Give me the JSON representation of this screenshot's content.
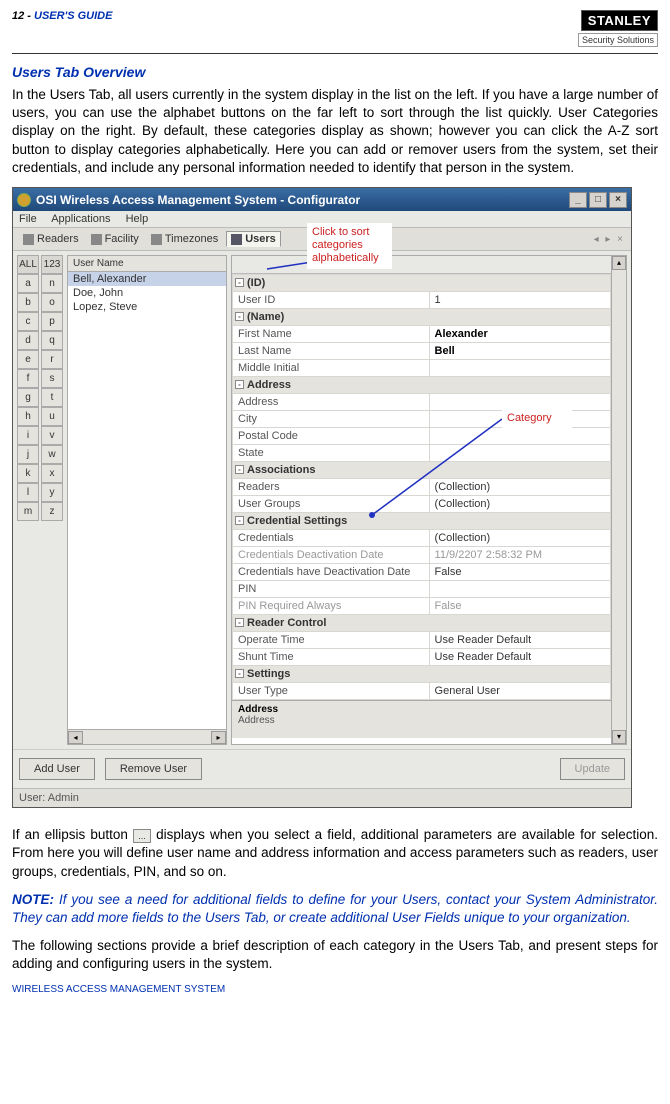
{
  "header": {
    "page_label": "12 - ",
    "guide_label": "USER'S GUIDE",
    "logo_main": "STANLEY",
    "logo_sub": "Security Solutions"
  },
  "section_title": "Users Tab Overview",
  "para1": "In the Users Tab, all users currently in the system display in the list on the left.   If you have a large number of users, you can use the alphabet buttons on the far left to sort through the list quickly.   User Categories display on the right.   By default, these categories display as shown; however you can click the A-Z sort button to display categories alphabetically.   Here you can add or remover users from the system, set their credentials, and include any personal information needed to identify that person in the system.",
  "para2a": "If an ellipsis button ",
  "para2b": " displays when you select a field, additional parameters are available for selection. From here you will define user name and address information and access parameters such as readers, user groups, credentials, PIN, and so on.",
  "note_label": "NOTE:",
  "note_body": "   If you see a need for additional fields to define for your Users, contact your System Administrator.    They can add more fields to the Users Tab, or create additional User Fields unique to your organization.",
  "para3": "The following sections provide a brief description of each category in the Users Tab, and present steps for adding and configuring users in the system.",
  "footer": "WIRELESS ACCESS MANAGEMENT SYSTEM",
  "callouts": {
    "sort": "Click to sort categories alphabetically",
    "category": "Category"
  },
  "window": {
    "title": "OSI Wireless Access Management System - Configurator",
    "menus": [
      "File",
      "Applications",
      "Help"
    ],
    "tabs": [
      "Readers",
      "Facility",
      "Timezones",
      "Users"
    ],
    "alpha_headers": [
      "ALL",
      "123"
    ],
    "alpha_left": [
      "a",
      "b",
      "c",
      "d",
      "e",
      "f",
      "g",
      "h",
      "i",
      "j",
      "k",
      "l",
      "m"
    ],
    "alpha_right": [
      "n",
      "o",
      "p",
      "q",
      "r",
      "s",
      "t",
      "u",
      "v",
      "w",
      "x",
      "y",
      "z"
    ],
    "userlist_header": "User Name",
    "users": [
      "Bell, Alexander",
      "Doe, John",
      "Lopez, Steve"
    ],
    "buttons": {
      "add": "Add User",
      "remove": "Remove User",
      "update": "Update"
    },
    "statusbar": "User: Admin",
    "desc_title": "Address",
    "desc_body": "Address",
    "properties": [
      {
        "type": "cat",
        "label": "(ID)"
      },
      {
        "type": "row",
        "k": "User ID",
        "v": "1"
      },
      {
        "type": "cat",
        "label": "(Name)"
      },
      {
        "type": "row",
        "k": "First Name",
        "v": "Alexander",
        "bold": true
      },
      {
        "type": "row",
        "k": "Last Name",
        "v": "Bell",
        "bold": true
      },
      {
        "type": "row",
        "k": "Middle Initial",
        "v": ""
      },
      {
        "type": "cat",
        "label": "Address"
      },
      {
        "type": "row",
        "k": "Address",
        "v": ""
      },
      {
        "type": "row",
        "k": "City",
        "v": ""
      },
      {
        "type": "row",
        "k": "Postal Code",
        "v": ""
      },
      {
        "type": "row",
        "k": "State",
        "v": ""
      },
      {
        "type": "cat",
        "label": "Associations"
      },
      {
        "type": "row",
        "k": "Readers",
        "v": "(Collection)"
      },
      {
        "type": "row",
        "k": "User Groups",
        "v": "(Collection)"
      },
      {
        "type": "cat",
        "label": "Credential Settings"
      },
      {
        "type": "row",
        "k": "Credentials",
        "v": "(Collection)"
      },
      {
        "type": "row",
        "k": "Credentials Deactivation Date",
        "v": "11/9/2207 2:58:32 PM",
        "dim": true,
        "kdim": true
      },
      {
        "type": "row",
        "k": "Credentials have Deactivation Date",
        "v": "False"
      },
      {
        "type": "row",
        "k": "PIN",
        "v": ""
      },
      {
        "type": "row",
        "k": "PIN Required Always",
        "v": "False",
        "dim": true,
        "kdim": true
      },
      {
        "type": "cat",
        "label": "Reader Control"
      },
      {
        "type": "row",
        "k": "Operate Time",
        "v": "Use Reader Default"
      },
      {
        "type": "row",
        "k": "Shunt Time",
        "v": "Use Reader Default"
      },
      {
        "type": "cat",
        "label": "Settings"
      },
      {
        "type": "row",
        "k": "User Type",
        "v": "General User"
      }
    ]
  }
}
